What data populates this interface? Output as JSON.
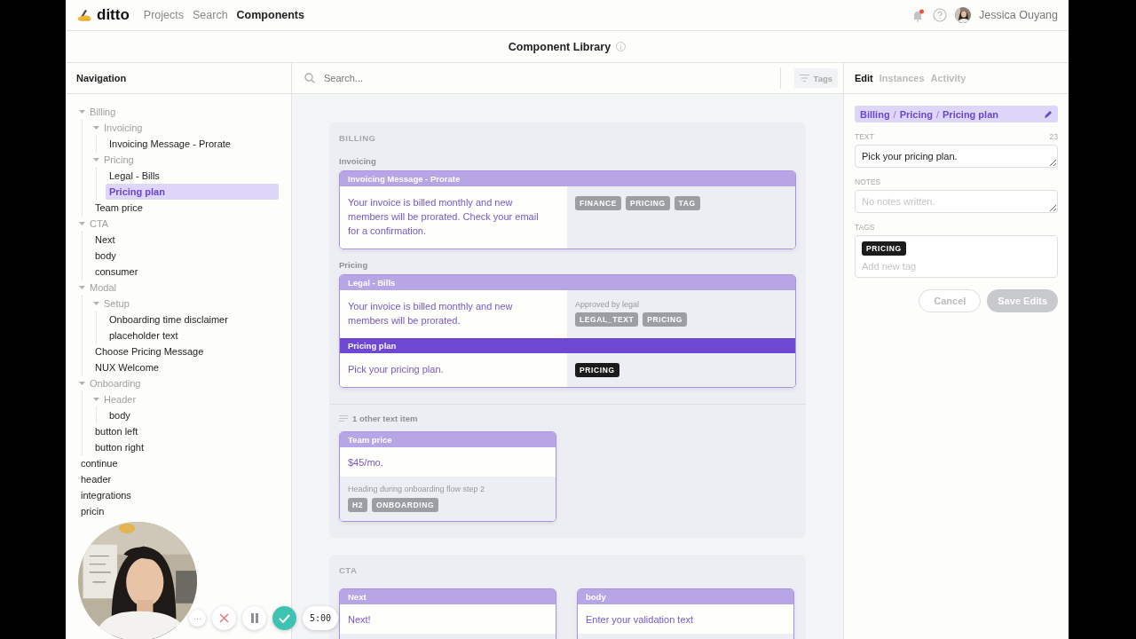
{
  "app": {
    "logo": "ditto"
  },
  "nav_links": [
    {
      "label": "Projects",
      "selected": false
    },
    {
      "label": "Search",
      "selected": false
    },
    {
      "label": "Components",
      "selected": true
    }
  ],
  "user": {
    "name": "Jessica Ouyang",
    "unread": true
  },
  "page_title": "Component Library",
  "navigation": {
    "title": "Navigation",
    "tree": [
      {
        "label": "Billing",
        "kind": "folder",
        "expanded": true,
        "selected": false,
        "children": [
          {
            "label": "Invoicing",
            "kind": "folder",
            "expanded": true,
            "selected": false,
            "children": [
              {
                "label": "Invoicing Message - Prorate",
                "kind": "item",
                "selected": false
              }
            ]
          },
          {
            "label": "Pricing",
            "kind": "folder",
            "expanded": true,
            "selected": false,
            "children": [
              {
                "label": "Legal - Bills",
                "kind": "item",
                "selected": false
              },
              {
                "label": "Pricing plan",
                "kind": "item",
                "selected": true
              }
            ]
          },
          {
            "label": "Team price",
            "kind": "item",
            "selected": false
          }
        ]
      },
      {
        "label": "CTA",
        "kind": "folder",
        "expanded": true,
        "selected": false,
        "children": [
          {
            "label": "Next",
            "kind": "item",
            "selected": false
          },
          {
            "label": "body",
            "kind": "item",
            "selected": false
          },
          {
            "label": "consumer",
            "kind": "item",
            "selected": false
          }
        ]
      },
      {
        "label": "Modal",
        "kind": "folder",
        "expanded": true,
        "selected": false,
        "children": [
          {
            "label": "Setup",
            "kind": "folder",
            "expanded": true,
            "selected": false,
            "children": [
              {
                "label": "Onboarding time disclaimer",
                "kind": "item",
                "selected": false
              },
              {
                "label": "placeholder text",
                "kind": "item",
                "selected": false
              }
            ]
          },
          {
            "label": "Choose Pricing Message",
            "kind": "item",
            "selected": false
          },
          {
            "label": "NUX Welcome",
            "kind": "item",
            "selected": false
          }
        ]
      },
      {
        "label": "Onboarding",
        "kind": "folder",
        "expanded": true,
        "selected": false,
        "children": [
          {
            "label": "Header",
            "kind": "folder",
            "expanded": true,
            "selected": false,
            "children": [
              {
                "label": "body",
                "kind": "item",
                "selected": false
              }
            ]
          },
          {
            "label": "button left",
            "kind": "item",
            "selected": false
          },
          {
            "label": "button right",
            "kind": "item",
            "selected": false
          }
        ]
      },
      {
        "label": "continue",
        "kind": "item",
        "selected": false
      },
      {
        "label": "header",
        "kind": "item",
        "selected": false
      },
      {
        "label": "integrations",
        "kind": "item",
        "selected": false
      },
      {
        "label": "pricin",
        "kind": "item",
        "selected": false
      }
    ]
  },
  "search": {
    "placeholder": "Search..."
  },
  "filter_button": "Tags",
  "sections": [
    {
      "title": "BILLING",
      "groups": [
        {
          "kind": "full",
          "title": "Invoicing",
          "cards": [
            {
              "items": [
                {
                  "name": "Invoicing Message - Prorate",
                  "text": "Your invoice is billed monthly and new members will be prorated. Check your email for a confirmation.",
                  "selected": false,
                  "tags": [
                    "FINANCE",
                    "PRICING",
                    "TAG"
                  ]
                }
              ]
            }
          ]
        },
        {
          "kind": "full",
          "title": "Pricing",
          "cards": [
            {
              "items": [
                {
                  "name": "Legal - Bills",
                  "text": "Your invoice is billed monthly and new members will be prorated.",
                  "note": "Approved by legal",
                  "selected": false,
                  "tags": [
                    "LEGAL_TEXT",
                    "PRICING"
                  ]
                },
                {
                  "name": "Pricing plan",
                  "text": "Pick your pricing plan.",
                  "selected": true,
                  "tags": [
                    "PRICING"
                  ]
                }
              ]
            }
          ]
        },
        {
          "kind": "other",
          "title": "1 other text item",
          "cards": [
            {
              "items": [
                {
                  "name": "Team price",
                  "text": "$45/mo.",
                  "note": "Heading during onboarding flow step 2",
                  "selected": false,
                  "tags": [
                    "H2",
                    "ONBOARDING"
                  ]
                }
              ]
            }
          ]
        }
      ]
    },
    {
      "title": "CTA",
      "groups": [
        {
          "kind": "grid",
          "cards": [
            {
              "items": [
                {
                  "name": "Next",
                  "text": "Next!",
                  "selected": false
                }
              ]
            },
            {
              "items": [
                {
                  "name": "body",
                  "text": "Enter your validation text",
                  "selected": false
                }
              ]
            }
          ]
        }
      ]
    }
  ],
  "panel": {
    "tabs": [
      {
        "label": "Edit",
        "selected": true
      },
      {
        "label": "Instances",
        "selected": false
      },
      {
        "label": "Activity",
        "selected": false
      }
    ],
    "breadcrumb": [
      "Billing",
      "Pricing",
      "Pricing plan"
    ],
    "breadcrumb_separator": "/",
    "text_label": "TEXT",
    "char_count": "23",
    "text_value": "Pick your pricing plan.",
    "notes_label": "NOTES",
    "notes_placeholder": "No notes written.",
    "tags_label": "TAGS",
    "tags": [
      "PRICING"
    ],
    "tag_placeholder": "Add new tag",
    "buttons": [
      {
        "label": "Cancel",
        "kind": "secondary",
        "disabled": false
      },
      {
        "label": "Save Edits",
        "kind": "primary",
        "disabled": true
      }
    ]
  },
  "recorder": {
    "more": "···",
    "timer": "5:00"
  }
}
